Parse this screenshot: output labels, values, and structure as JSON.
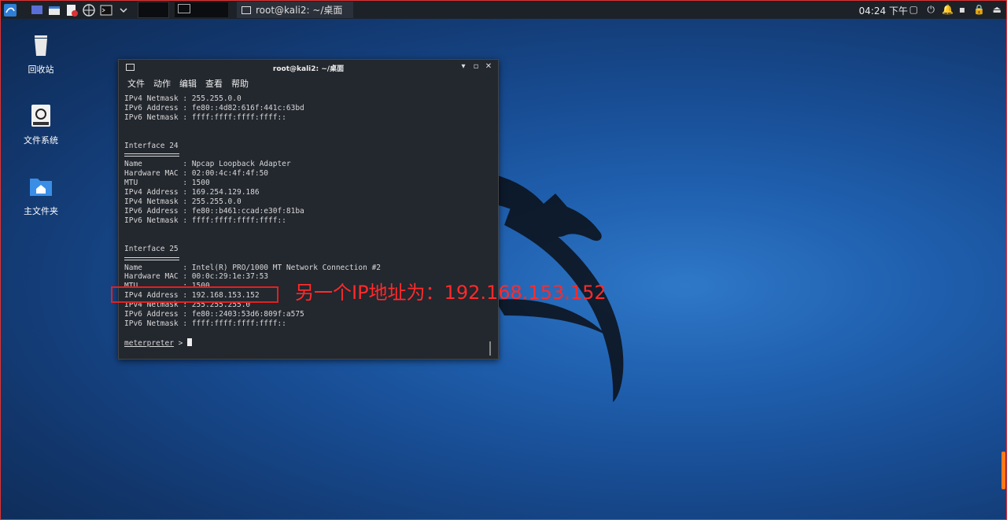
{
  "panel": {
    "task_title": "root@kali2: ~/桌面",
    "clock": "04:24 下午"
  },
  "desktop": {
    "icons": [
      {
        "label": "回收站",
        "icon": "trash-icon"
      },
      {
        "label": "文件系统",
        "icon": "drive-icon"
      },
      {
        "label": "主文件夹",
        "icon": "home-folder-icon"
      }
    ]
  },
  "terminal": {
    "title": "root@kali2: ~/桌面",
    "menu": [
      "文件",
      "动作",
      "编辑",
      "查看",
      "帮助"
    ],
    "lines": [
      "IPv4 Netmask : 255.255.0.0",
      "IPv6 Address : fe80::4d82:616f:441c:63bd",
      "IPv6 Netmask : ffff:ffff:ffff:ffff::",
      "",
      "",
      "Interface 24",
      "__DASH__",
      "Name         : Npcap Loopback Adapter",
      "Hardware MAC : 02:00:4c:4f:4f:50",
      "MTU          : 1500",
      "IPv4 Address : 169.254.129.186",
      "IPv4 Netmask : 255.255.0.0",
      "IPv6 Address : fe80::b461:ccad:e30f:81ba",
      "IPv6 Netmask : ffff:ffff:ffff:ffff::",
      "",
      "",
      "Interface 25",
      "__DASH__",
      "Name         : Intel(R) PRO/1000 MT Network Connection #2",
      "Hardware MAC : 00:0c:29:1e:37:53",
      "MTU          : 1500",
      "IPv4 Address : 192.168.153.152",
      "IPv4 Netmask : 255.255.255.0",
      "IPv6 Address : fe80::2403:53d6:809f:a575",
      "IPv6 Netmask : ffff:ffff:ffff:ffff::",
      ""
    ],
    "prompt": "meterpreter",
    "prompt_suffix": " > "
  },
  "annotation": {
    "text": "另一个IP地址为：192.168.153.152",
    "color": "#ff2a2a"
  }
}
